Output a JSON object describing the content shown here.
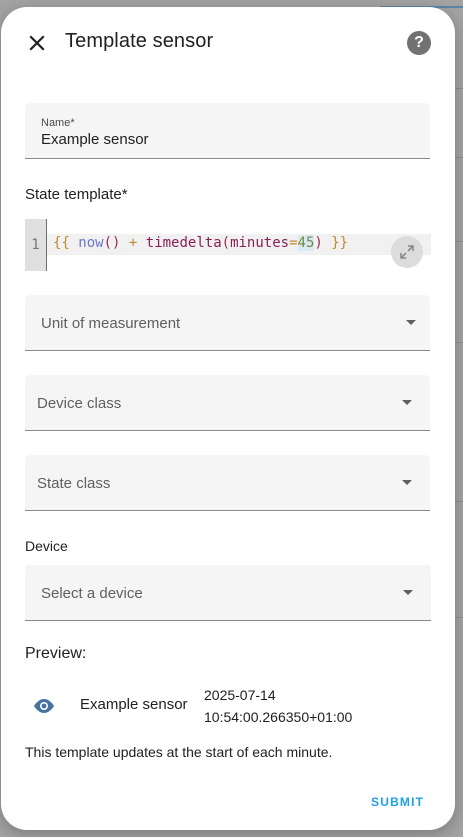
{
  "dialog": {
    "title": "Template sensor",
    "help_icon": "help-circle-icon",
    "close_icon": "close-icon"
  },
  "form": {
    "name": {
      "label": "Name*",
      "value": "Example sensor"
    },
    "state_template": {
      "label": "State template*",
      "line_number": "1",
      "tokens": {
        "open": "{{",
        "fn1": "now",
        "p1": "()",
        "plus": "+",
        "fn2": "timedelta",
        "lp": "(",
        "kw": "minutes",
        "eq": "=",
        "num": "45",
        "rp": ")",
        "close": "}}"
      },
      "expand_icon": "arrow-expand-icon"
    },
    "unit_of_measurement": {
      "placeholder": "Unit of measurement"
    },
    "device_class": {
      "placeholder": "Device class"
    },
    "state_class": {
      "placeholder": "State class"
    },
    "device": {
      "label": "Device",
      "placeholder": "Select a device"
    }
  },
  "preview": {
    "label": "Preview:",
    "entity_icon": "eye-icon",
    "entity_name": "Example sensor",
    "state_line1": "2025-07-14",
    "state_line2": "10:54:00.266350+01:00",
    "note": "This template updates at the start of each minute."
  },
  "actions": {
    "submit": "SUBMIT"
  },
  "colors": {
    "accent": "#1ea1e6",
    "field_bg": "#f5f5f5",
    "icon": "#727272"
  }
}
